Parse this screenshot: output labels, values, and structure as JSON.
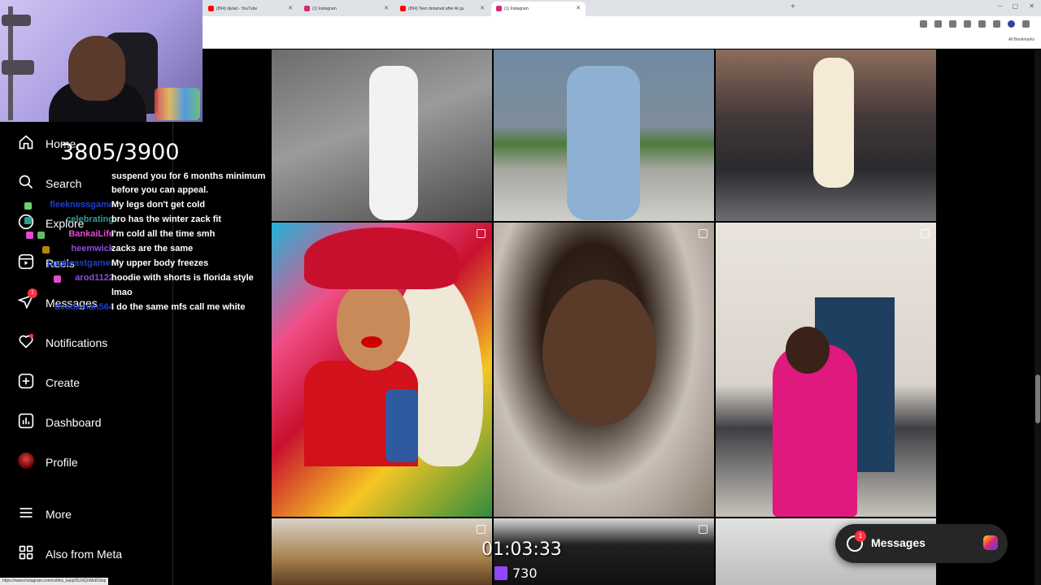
{
  "browser": {
    "tabs": [
      {
        "title": "(854) djvlad - YouTube",
        "icon_color": "#ff0000",
        "active": false
      },
      {
        "title": "(1) Instagram",
        "icon_color": "#d62976",
        "active": false
      },
      {
        "title": "(854) Teen detained after AI gu",
        "icon_color": "#ff0000",
        "active": false
      },
      {
        "title": "(1) Instagram",
        "icon_color": "#d62976",
        "active": true
      }
    ],
    "new_tab": "+",
    "all_bookmarks": "All Bookmarks",
    "status_url": "https://www.instagram.com/collins_kai/p/DLNQUMsR1bq/"
  },
  "sidebar": {
    "items": [
      {
        "label": "Home",
        "icon": "home-icon"
      },
      {
        "label": "Search",
        "icon": "search-icon"
      },
      {
        "label": "Explore",
        "icon": "compass-icon"
      },
      {
        "label": "Reels",
        "icon": "reels-icon"
      },
      {
        "label": "Messages",
        "icon": "send-icon",
        "badge": "1"
      },
      {
        "label": "Notifications",
        "icon": "heart-icon"
      },
      {
        "label": "Create",
        "icon": "plus-square-icon"
      },
      {
        "label": "Dashboard",
        "icon": "chart-icon"
      },
      {
        "label": "Profile",
        "icon": "avatar"
      },
      {
        "label": "More",
        "icon": "menu-icon"
      },
      {
        "label": "Also from Meta",
        "icon": "meta-apps-icon"
      }
    ]
  },
  "stream": {
    "counter": "3805/3900",
    "timer": "01:03:33",
    "viewers": "730"
  },
  "chat": [
    {
      "user": "",
      "message": "suspend you for 6 months minimum",
      "user_color": "#ffffff"
    },
    {
      "user": "",
      "message": "before you can appeal.",
      "user_color": "#ffffff"
    },
    {
      "user": "fleeknessgame",
      "message": "My legs don't get cold",
      "user_color": "#1e3ecf"
    },
    {
      "user": "celebrating",
      "message": "bro has the winter zack fit",
      "user_color": "#2f9e8f"
    },
    {
      "user": "BankaiLife",
      "message": "I'm cold all the time smh",
      "user_color": "#e34bd1"
    },
    {
      "user": "heemwick",
      "message": "zacks are the same",
      "user_color": "#8a4ce0"
    },
    {
      "user": "ppgbeastgamer",
      "message": "My upper body freezes",
      "user_color": "#1e3ecf"
    },
    {
      "user": "arod1122",
      "message": "hoodie with shorts is florida style",
      "user_color": "#8a4ce0"
    },
    {
      "user": "",
      "message": "lmao",
      "user_color": "#ffffff"
    },
    {
      "user": "deadxman564",
      "message": "I do the same mfs call me white",
      "user_color": "#1e3ecf"
    }
  ],
  "messages_pill": {
    "label": "Messages",
    "badge": "1"
  },
  "colors": {
    "badge": "#ff3040",
    "twitch": "#9146ff",
    "background": "#000000"
  }
}
